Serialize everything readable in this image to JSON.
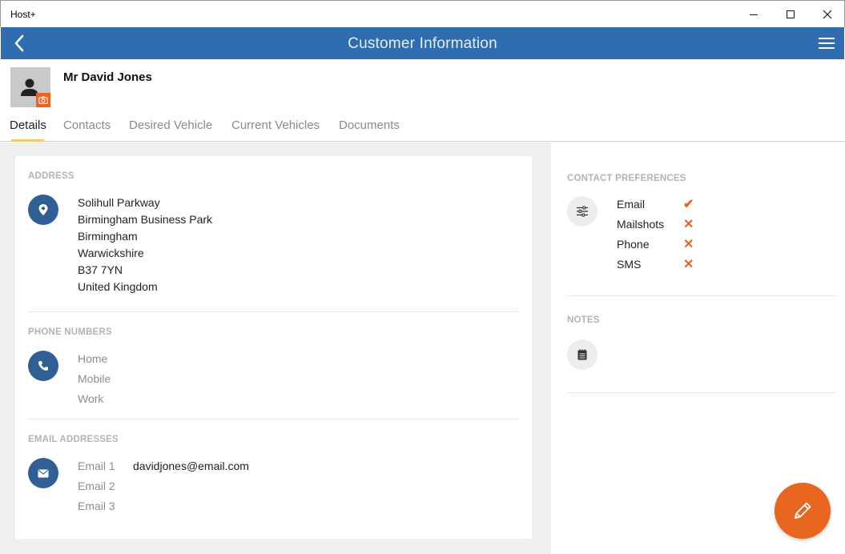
{
  "window": {
    "title": "Host+",
    "minimize_icon": "minimize-icon",
    "maximize_icon": "maximize-icon",
    "close_icon": "close-icon"
  },
  "header": {
    "title": "Customer Information",
    "back_icon": "chevron-left-icon",
    "menu_icon": "hamburger-menu-icon",
    "color": "#2e6db0"
  },
  "customer": {
    "name": "Mr David Jones",
    "avatar_icon": "person-icon",
    "camera_icon": "camera-icon"
  },
  "tabs": [
    {
      "label": "Details",
      "active": true
    },
    {
      "label": "Contacts",
      "active": false
    },
    {
      "label": "Desired Vehicle",
      "active": false
    },
    {
      "label": "Current Vehicles",
      "active": false
    },
    {
      "label": "Documents",
      "active": false
    }
  ],
  "address": {
    "label": "ADDRESS",
    "icon": "location-pin-icon",
    "lines": [
      "Solihull Parkway",
      "Birmingham Business Park",
      "Birmingham",
      "Warwickshire",
      "B37 7YN",
      "United Kingdom"
    ]
  },
  "phones": {
    "label": "PHONE NUMBERS",
    "icon": "phone-icon",
    "items": [
      {
        "label": "Home",
        "value": ""
      },
      {
        "label": "Mobile",
        "value": ""
      },
      {
        "label": "Work",
        "value": ""
      }
    ]
  },
  "emails": {
    "label": "EMAIL ADDRESSES",
    "icon": "envelope-icon",
    "items": [
      {
        "label": "Email 1",
        "value": "davidjones@email.com"
      },
      {
        "label": "Email 2",
        "value": ""
      },
      {
        "label": "Email 3",
        "value": ""
      }
    ]
  },
  "contact_preferences": {
    "label": "CONTACT PREFERENCES",
    "icon": "sliders-icon",
    "items": [
      {
        "label": "Email",
        "mark": "✔",
        "enabled": true
      },
      {
        "label": "Mailshots",
        "mark": "✕",
        "enabled": false
      },
      {
        "label": "Phone",
        "mark": "✕",
        "enabled": false
      },
      {
        "label": "SMS",
        "mark": "✕",
        "enabled": false
      }
    ]
  },
  "notes": {
    "label": "NOTES",
    "icon": "notepad-icon"
  },
  "fab": {
    "icon": "pencil-icon",
    "color": "#e8661d"
  }
}
